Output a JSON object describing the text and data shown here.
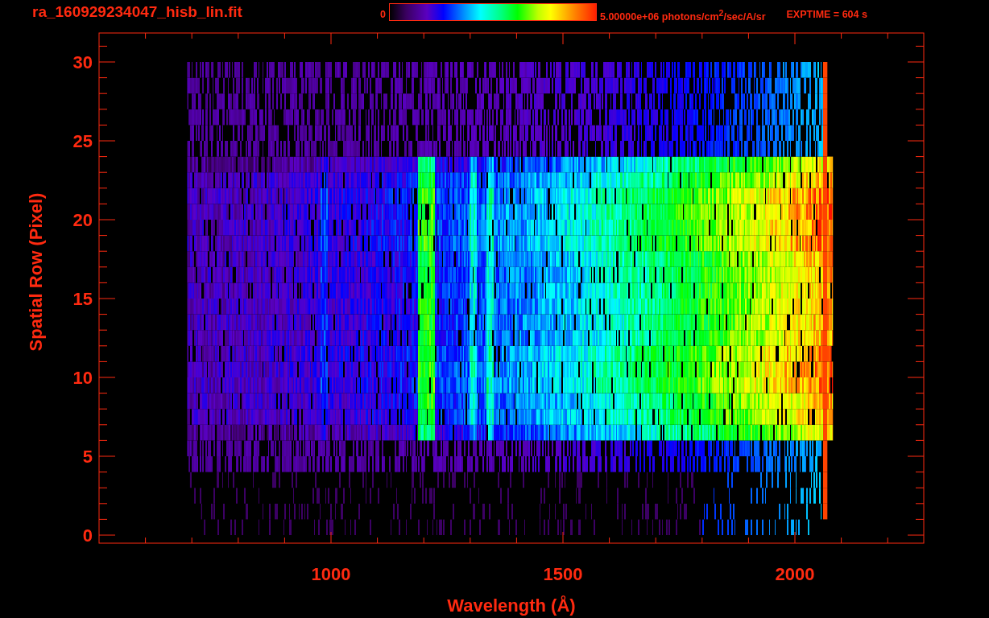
{
  "title": "ra_160929234047_hisb_lin.fit",
  "colorbar": {
    "min_label": "0",
    "max_label": "5.00000e+06 photons/cm$^{2}$/sec/A/sr"
  },
  "exposure": "EXPTIME = 604 s",
  "plot": {
    "xlabel": "Wavelength (Å)",
    "ylabel": "Spatial Row (Pixel)",
    "xticks": [
      "1000",
      "1500",
      "2000"
    ],
    "yticks": [
      "30",
      "25",
      "20",
      "15",
      "10",
      "5",
      "0"
    ]
  }
}
